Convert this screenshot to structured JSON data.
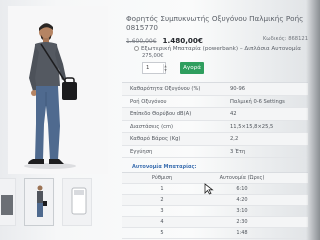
{
  "product": {
    "title": "Φορητός Συμπυκνωτής Οξυγόνου Παλμικής Ροής 0815770",
    "old_price": "1.600,00€",
    "new_price": "1.480,00€",
    "code": "Κωδικός: 868121"
  },
  "option": {
    "label": "Εξωτερική Μπαταρία (powerbank) – Διπλάσια Αυτονομία",
    "price": "275,00€"
  },
  "purchase": {
    "quantity": "1",
    "buy_label": "Αγορά"
  },
  "specs": [
    {
      "name": "Καθαρότητα Οξυγόνου (%)",
      "value": "90-96"
    },
    {
      "name": "Ροή Οξυγόνου",
      "value": "Παλμική 0-6 Settings"
    },
    {
      "name": "Επίπεδο Θορύβου dB(A)",
      "value": "42"
    },
    {
      "name": "Διαστάσεις (cm)",
      "value": "11,5×15,8×25,5"
    },
    {
      "name": "Καθαρό Βάρος (Kg)",
      "value": "2,2"
    },
    {
      "name": "Εγγύηση",
      "value": "3 Έτη"
    }
  ],
  "battery": {
    "heading": "Αυτονομία Μπαταρίας:",
    "col1": "Ρύθμιση",
    "col2": "Αυτονομία (Ώρες)",
    "rows": [
      {
        "setting": "1",
        "hours": "6:10"
      },
      {
        "setting": "2",
        "hours": "4:20"
      },
      {
        "setting": "3",
        "hours": "3:10"
      },
      {
        "setting": "4",
        "hours": "2:30"
      },
      {
        "setting": "5",
        "hours": "1:48"
      }
    ]
  },
  "colors": {
    "buy_button": "#2f9e5e",
    "heading_link": "#3c6fb0"
  }
}
